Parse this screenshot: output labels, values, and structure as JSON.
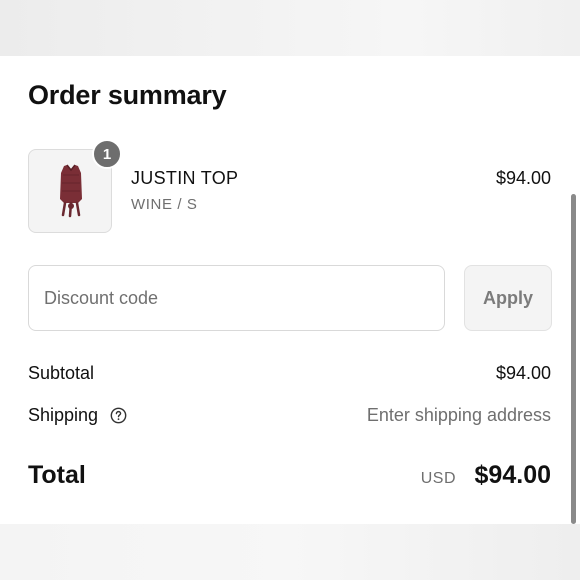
{
  "order_summary": {
    "title": "Order summary"
  },
  "line_item": {
    "quantity": "1",
    "name": "JUSTIN TOP",
    "variant": "WINE / S",
    "price": "$94.00",
    "image_icon": "wine-vest-top-thumbnail"
  },
  "discount": {
    "placeholder": "Discount code",
    "value": "",
    "apply_label": "Apply"
  },
  "summary": {
    "subtotal_label": "Subtotal",
    "subtotal_value": "$94.00",
    "shipping_label": "Shipping",
    "shipping_value": "Enter shipping address",
    "shipping_help_icon": "question-circle-icon"
  },
  "total": {
    "label": "Total",
    "currency": "USD",
    "value": "$94.00"
  },
  "colors": {
    "text_primary": "#111111",
    "text_secondary": "#6f6f6f",
    "badge": "#6e6e6e",
    "product": "#7a2e36"
  }
}
